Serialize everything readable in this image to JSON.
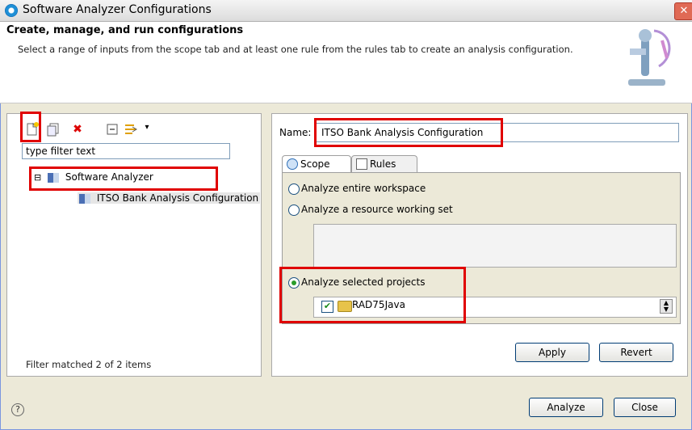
{
  "window": {
    "title": "Software Analyzer Configurations",
    "close_glyph": "✕"
  },
  "header": {
    "title": "Create, manage, and run configurations",
    "description": "Select a range of inputs from the scope tab and at least one rule from the rules tab to create an analysis configuration."
  },
  "toolbar": {
    "icons": [
      "new-configuration-icon",
      "duplicate-icon",
      "delete-icon",
      "collapse-all-icon",
      "filter-icon"
    ],
    "delete_glyph": "✖",
    "dropdown_glyph": "▾"
  },
  "filter": {
    "placeholder": "type filter text"
  },
  "tree": {
    "root_label": "Software Analyzer",
    "child_label": "ITSO Bank Analysis Configuration",
    "expander": "⊟"
  },
  "filter_status": "Filter matched 2 of 2 items",
  "config": {
    "name_label": "Name:",
    "name_value": "ITSO Bank Analysis Configuration"
  },
  "tabs": [
    {
      "label": "Scope"
    },
    {
      "label": "Rules"
    }
  ],
  "scope": {
    "option_workspace": "Analyze entire workspace",
    "option_working_set": "Analyze a resource working set",
    "option_projects": "Analyze selected projects",
    "project_name": "RAD75Java",
    "check_glyph": "✔"
  },
  "buttons": {
    "apply": "Apply",
    "revert": "Revert",
    "analyze": "Analyze",
    "close": "Close"
  },
  "help_glyph": "?",
  "colors": {
    "highlight": "#e00000",
    "dialog_bg": "#ece9d8"
  }
}
